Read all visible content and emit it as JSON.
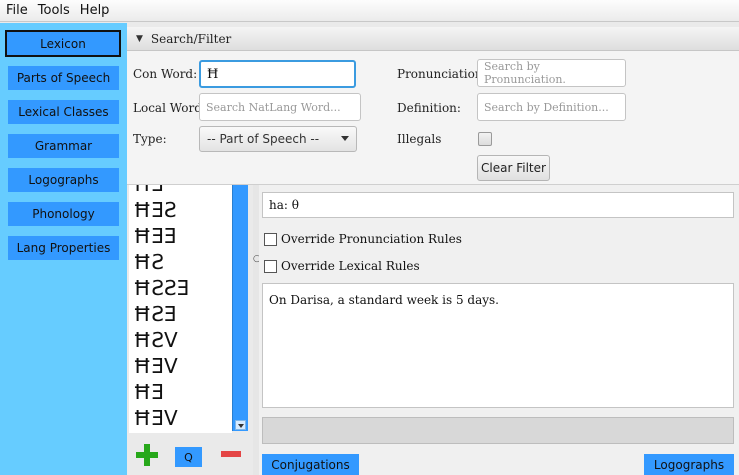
{
  "menu": [
    "File",
    "Tools",
    "Help"
  ],
  "sidebar": {
    "items": [
      {
        "label": "Lexicon"
      },
      {
        "label": "Parts of Speech"
      },
      {
        "label": "Lexical Classes"
      },
      {
        "label": "Grammar"
      },
      {
        "label": "Logographs"
      },
      {
        "label": "Phonology"
      },
      {
        "label": "Lang Properties"
      }
    ]
  },
  "filter": {
    "title": "Search/Filter",
    "con_word_label": "Con Word:",
    "con_word_value": "Ħ",
    "local_word_label": "Local Word:",
    "local_word_placeholder": "Search NatLang Word...",
    "type_label": "Type:",
    "type_value": "-- Part of Speech --",
    "pronunciation_label": "Pronunciation:",
    "pronunciation_placeholder": "Search by Pronunciation.",
    "definition_label": "Definition:",
    "definition_placeholder": "Search by Definition...",
    "illegals_label": "Illegals",
    "clear_label": "Clear Filter"
  },
  "word_list": [
    "ĦƎ",
    "ĦƎƧ",
    "ĦƎƎ",
    "ĦƧ",
    "ĦƧƧƎ",
    "ĦƧƎ",
    "ĦƧV",
    "ĦƎV",
    "ĦƎ",
    "ĦƎV"
  ],
  "list_controls": {
    "query_label": "Q"
  },
  "detail": {
    "pronunciation": "ha: θ",
    "override_pron": "Override Pronunciation Rules",
    "override_lex": "Override Lexical Rules",
    "notes": "On Darisa, a standard week is 5 days."
  },
  "bottom": {
    "conjugations": "Conjugations",
    "logographs": "Logographs"
  },
  "colors": {
    "sidebar_bg": "#66ccff",
    "button_blue": "#3399ff",
    "add_green": "#27a81a",
    "delete_red": "#e44545"
  }
}
